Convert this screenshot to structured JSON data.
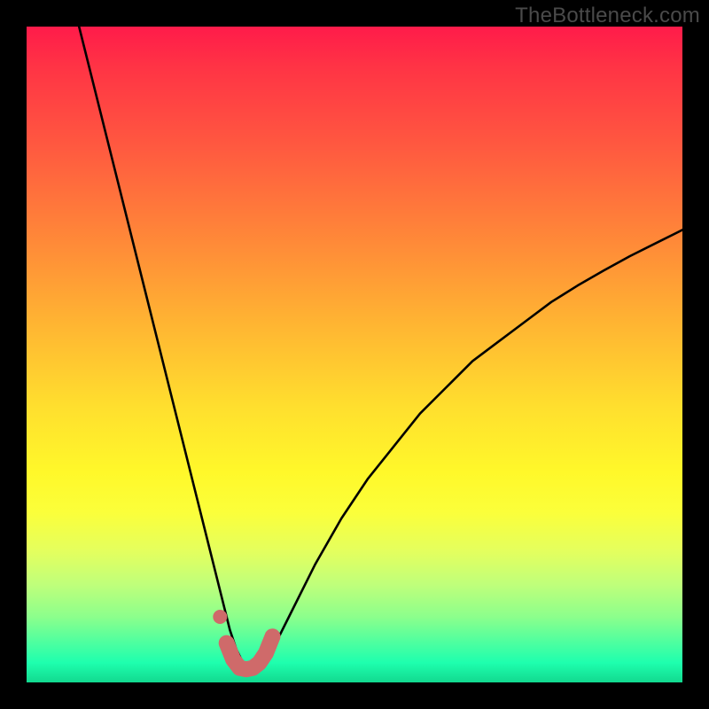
{
  "watermark": "TheBottleneck.com",
  "colors": {
    "background": "#000000",
    "curve_stroke": "#000000",
    "marker_stroke": "#cf6a6a",
    "gradient_top": "#ff1b4a",
    "gradient_bottom": "#12d98f"
  },
  "chart_data": {
    "type": "line",
    "title": "",
    "xlabel": "",
    "ylabel": "",
    "xlim": [
      0,
      100
    ],
    "ylim": [
      0,
      100
    ],
    "grid": false,
    "series": [
      {
        "name": "bottleneck-curve",
        "x": [
          8,
          10,
          12,
          14,
          16,
          18,
          20,
          22,
          24,
          26,
          28,
          30,
          31,
          32,
          33,
          34,
          35,
          36,
          38,
          40,
          44,
          48,
          52,
          56,
          60,
          64,
          68,
          72,
          76,
          80,
          84,
          88,
          92,
          96,
          100
        ],
        "y": [
          100,
          92,
          84,
          76,
          68,
          60,
          52,
          44,
          36,
          28,
          20,
          12,
          8,
          5,
          3,
          2,
          2,
          3,
          6,
          10,
          18,
          25,
          31,
          36,
          41,
          45,
          49,
          52,
          55,
          58,
          60.5,
          62.8,
          65,
          67,
          69
        ]
      }
    ],
    "marker_region": {
      "name": "highlight-trough",
      "x": [
        29.5,
        30.5,
        31.5,
        32.5,
        33.5,
        34.5,
        35.5,
        36.5,
        37.5
      ],
      "y": [
        10,
        6,
        3.5,
        2.2,
        2,
        2.2,
        3,
        4.5,
        7
      ]
    }
  }
}
